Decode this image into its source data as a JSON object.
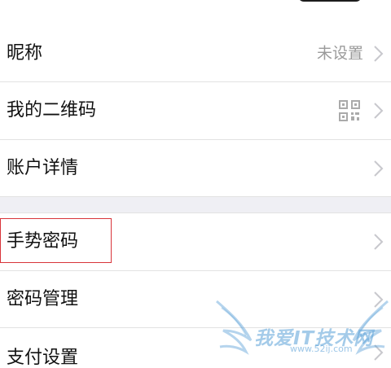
{
  "rows": [
    {
      "label": "昵称",
      "value": "未设置"
    },
    {
      "label": "我的二维码"
    },
    {
      "label": "账户详情"
    },
    {
      "label": "手势密码"
    },
    {
      "label": "密码管理"
    },
    {
      "label": "支付设置"
    }
  ],
  "watermark": {
    "text": "我爱IT技术网",
    "url": "www.52ij.com"
  },
  "icons": {
    "chevron": "chevron-right-icon",
    "qr": "qr-code-icon"
  },
  "colors": {
    "label_text": "#111111",
    "secondary_text": "#9a9a9a",
    "chevron": "#c8c8cd",
    "section_gap": "#efeff4",
    "highlight_border": "#d8343a",
    "watermark": "#5aa0d7"
  }
}
